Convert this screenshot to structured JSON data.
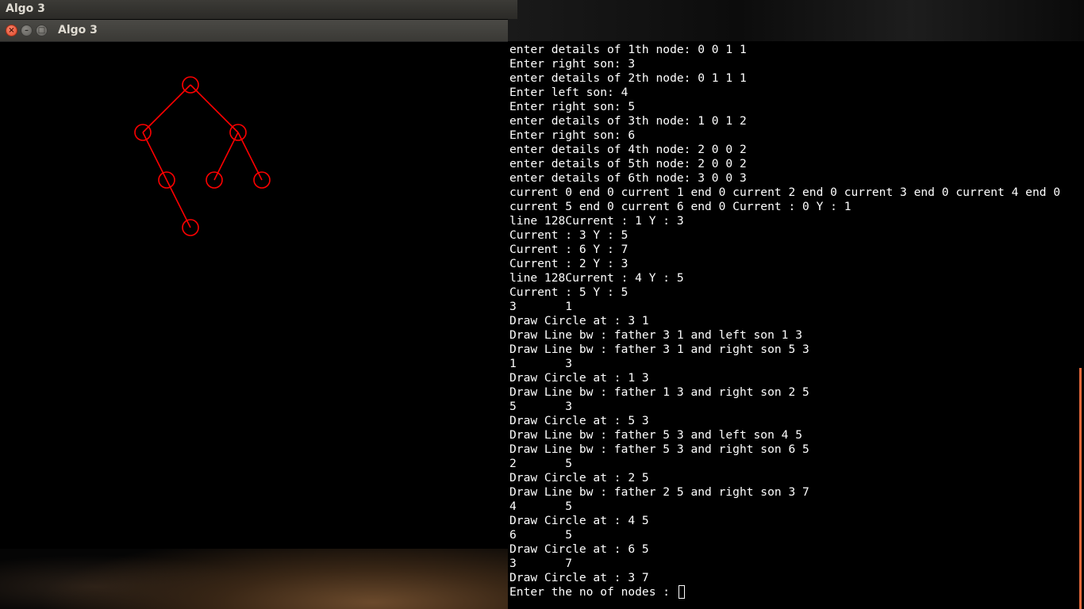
{
  "top_panel": {
    "title": "Algo 3"
  },
  "window": {
    "title": "Algo 3",
    "close_glyph": "×",
    "minimize_glyph": "–",
    "maximize_glyph": "□",
    "draw_color": "#ff0000"
  },
  "tree": {
    "nodes": [
      {
        "id": 0,
        "gx": 3,
        "gy": 1
      },
      {
        "id": 1,
        "gx": 1,
        "gy": 3
      },
      {
        "id": 2,
        "gx": 5,
        "gy": 3
      },
      {
        "id": 3,
        "gx": 2,
        "gy": 5
      },
      {
        "id": 4,
        "gx": 4,
        "gy": 5
      },
      {
        "id": 5,
        "gx": 6,
        "gy": 5
      },
      {
        "id": 6,
        "gx": 3,
        "gy": 7
      }
    ],
    "edges": [
      [
        0,
        1
      ],
      [
        0,
        2
      ],
      [
        1,
        3
      ],
      [
        2,
        4
      ],
      [
        2,
        5
      ],
      [
        3,
        6
      ]
    ]
  },
  "terminal": {
    "lines": [
      "enter details of 1th node: 0 0 1 1",
      "Enter right son: 3",
      "enter details of 2th node: 0 1 1 1",
      "Enter left son: 4",
      "Enter right son: 5",
      "enter details of 3th node: 1 0 1 2",
      "Enter right son: 6",
      "enter details of 4th node: 2 0 0 2",
      "enter details of 5th node: 2 0 0 2",
      "enter details of 6th node: 3 0 0 3",
      "current 0 end 0 current 1 end 0 current 2 end 0 current 3 end 0 current 4 end 0",
      "current 5 end 0 current 6 end 0 Current : 0 Y : 1",
      "line 128Current : 1 Y : 3",
      "Current : 3 Y : 5",
      "Current : 6 Y : 7",
      "Current : 2 Y : 3",
      "line 128Current : 4 Y : 5",
      "Current : 5 Y : 5",
      "3       1",
      "Draw Circle at : 3 1",
      "Draw Line bw : father 3 1 and left son 1 3",
      "Draw Line bw : father 3 1 and right son 5 3",
      "1       3",
      "Draw Circle at : 1 3",
      "Draw Line bw : father 1 3 and right son 2 5",
      "5       3",
      "Draw Circle at : 5 3",
      "Draw Line bw : father 5 3 and left son 4 5",
      "Draw Line bw : father 5 3 and right son 6 5",
      "2       5",
      "Draw Circle at : 2 5",
      "Draw Line bw : father 2 5 and right son 3 7",
      "4       5",
      "Draw Circle at : 4 5",
      "6       5",
      "Draw Circle at : 6 5",
      "3       7",
      "Draw Circle at : 3 7"
    ],
    "prompt": "Enter the no of nodes : "
  },
  "colors": {
    "terminal_bg": "#000000",
    "terminal_fg": "#ffffff",
    "scrollbar": "#e96a3c",
    "close_button": "#e0492b"
  }
}
